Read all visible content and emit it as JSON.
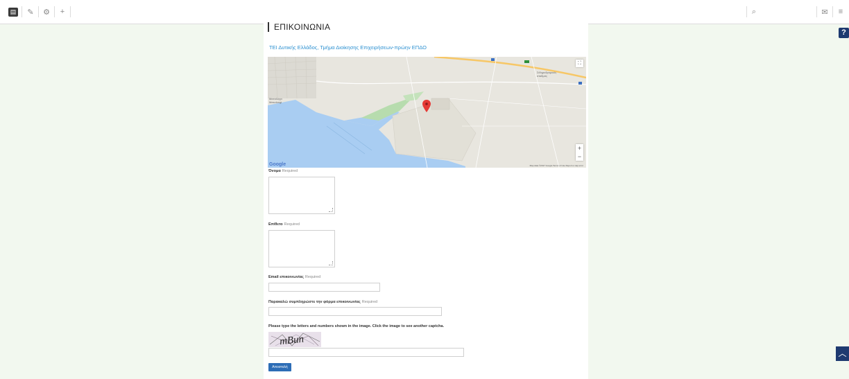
{
  "toolbar": {
    "icons": [
      "logo-icon",
      "pencil-icon",
      "gear-icon",
      "plus-icon",
      "search-icon",
      "chat-icon",
      "menu-icon"
    ]
  },
  "floating": {
    "help_label": "?",
    "scroll_top_label": "^"
  },
  "page": {
    "title": "ΕΠΙΚΟΙΝΩΝΙΑ",
    "org_link": "ΤΕΙ Δυτικής Ελλάδος, Τμήμα Διοίκησης Επιχειρήσεων-πρώην ΕΠΔΟ"
  },
  "map": {
    "credit": "Map data ©2017 Google  Terms of Use  Report a map error",
    "google_logo": "Google",
    "zoom_in": "+",
    "zoom_out": "−",
    "fullscreen": "⛶",
    "places": [
      "Μεσολόγγι\nMesolongi",
      "Σιδηροδρομικός\nσταθμός",
      "Αιτωλικό"
    ]
  },
  "form": {
    "required_label": "Required",
    "name_label": "Όνομα",
    "surname_label": "Επίθετο",
    "email_label": "Email επικοινωνίας",
    "message_label": "Παρακαλώ συμπληρώστε την φόρμα επικοινωνίας",
    "captcha_instructions": "Please type the letters and numbers shown in the image. Click the image to see another captcha.",
    "captcha_text": "mBun",
    "submit_label": "Αποστολή"
  },
  "colors": {
    "page_bg": "#f2f8ef",
    "accent": "#1e3a70",
    "link": "#2a8fd0",
    "button": "#2d6db6"
  }
}
